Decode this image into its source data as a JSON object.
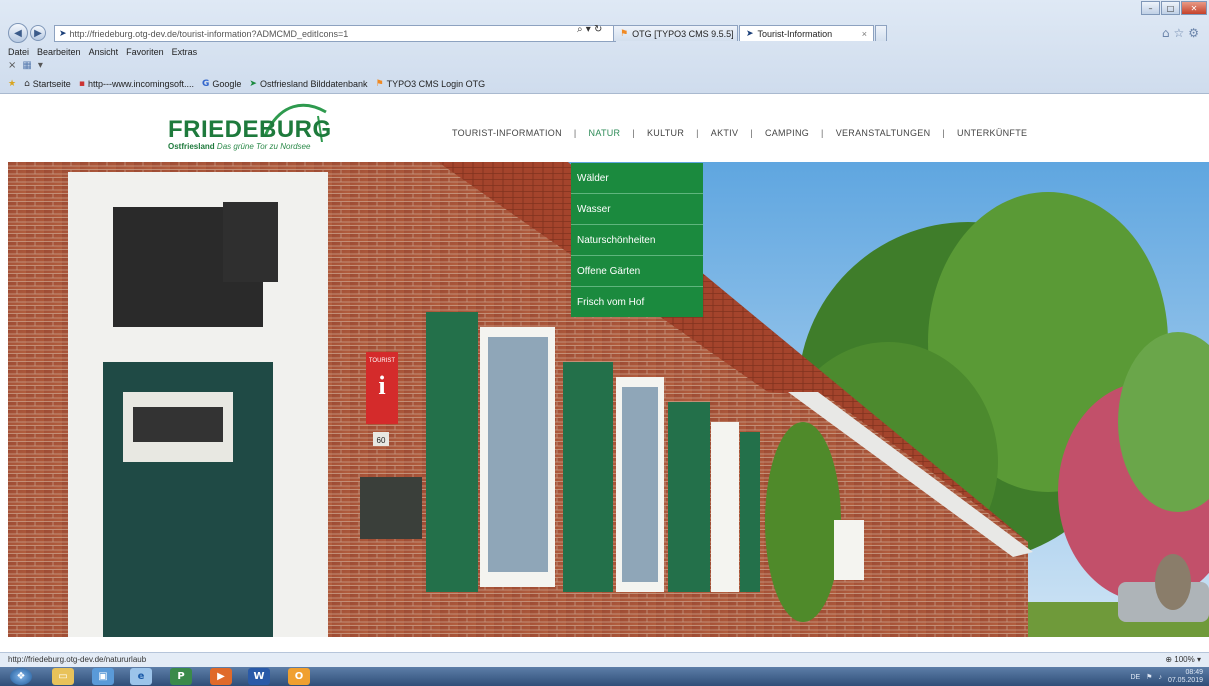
{
  "browser": {
    "url": "http://friedeburg.otg-dev.de/tourist-information?ADMCMD_editIcons=1",
    "url_host": "friedeburg.otg-dev.de",
    "tabs": [
      {
        "label": "OTG [TYPO3 CMS 9.5.5]",
        "active": false
      },
      {
        "label": "Tourist-Information",
        "active": true
      }
    ],
    "menu": [
      "Datei",
      "Bearbeiten",
      "Ansicht",
      "Favoriten",
      "Extras"
    ],
    "favorites": [
      {
        "label": "Startseite",
        "icon": "home-icon"
      },
      {
        "label": "http---www.incomingsoft....",
        "icon": "page-icon"
      },
      {
        "label": "Google",
        "icon": "google-icon"
      },
      {
        "label": "Ostfriesland Bilddatenbank",
        "icon": "otg-icon"
      },
      {
        "label": "TYPO3 CMS Login OTG",
        "icon": "typo3-icon"
      }
    ],
    "status_url": "http://friedeburg.otg-dev.de/natururlaub",
    "zoom": "100%"
  },
  "site": {
    "logo_name": "FRIEDEBURG",
    "logo_sub": "Ostfriesland",
    "logo_tagline": "Das grüne Tor zu Nordsee",
    "nav": [
      {
        "label": "TOURIST-INFORMATION",
        "active": false
      },
      {
        "label": "NATUR",
        "active": true
      },
      {
        "label": "KULTUR",
        "active": false
      },
      {
        "label": "AKTIV",
        "active": false
      },
      {
        "label": "CAMPING",
        "active": false
      },
      {
        "label": "VERANSTALTUNGEN",
        "active": false
      },
      {
        "label": "UNTERKÜNFTE",
        "active": false
      }
    ],
    "nav_separator": "|",
    "dropdown": [
      "Wälder",
      "Wasser",
      "Naturschönheiten",
      "Offene Gärten",
      "Frisch vom Hof"
    ],
    "hero_sign_text": "TOURIST",
    "hero_house_number": "60"
  },
  "taskbar": {
    "language": "DE",
    "time": "08:49",
    "date": "07.05.2019"
  },
  "colors": {
    "accent_green": "#1b8a3e",
    "nav_active": "#2e8b57"
  }
}
